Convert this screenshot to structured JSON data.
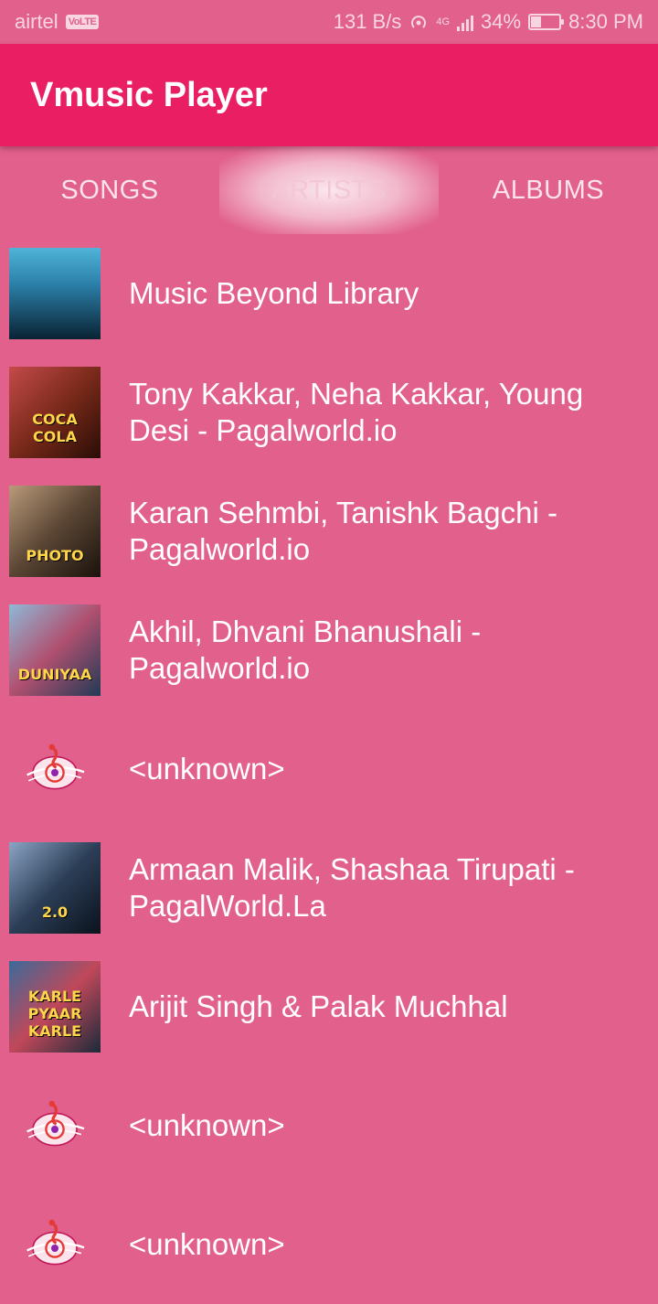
{
  "status_bar": {
    "carrier": "airtel",
    "volte": "VoLTE",
    "speed": "131 B/s",
    "network": "4G",
    "battery": "34%",
    "battery_level": 0.34,
    "time": "8:30 PM"
  },
  "app_bar": {
    "title": "Vmusic Player"
  },
  "tabs": [
    {
      "label": "SONGS"
    },
    {
      "label": "ARTISTS"
    },
    {
      "label": "ALBUMS"
    }
  ],
  "active_tab": "ARTISTS",
  "artists": [
    {
      "name": "Music Beyond Library",
      "thumb": "crowd",
      "thumb_text": ""
    },
    {
      "name": "Tony Kakkar, Neha Kakkar, Young Desi - Pagalworld.io",
      "thumb": "coca",
      "thumb_text": "COCA COLA"
    },
    {
      "name": "Karan Sehmbi, Tanishk Bagchi - Pagalworld.io",
      "thumb": "photo",
      "thumb_text": "PHOTO"
    },
    {
      "name": "Akhil, Dhvani Bhanushali - Pagalworld.io",
      "thumb": "duniya",
      "thumb_text": "DUNIYAA"
    },
    {
      "name": "<unknown>",
      "thumb": "note",
      "thumb_text": ""
    },
    {
      "name": "Armaan Malik, Shashaa Tirupati - PagalWorld.La",
      "thumb": "robot",
      "thumb_text": "2.0"
    },
    {
      "name": "Arijit Singh & Palak Muchhal",
      "thumb": "karle",
      "thumb_text": "KARLE PYAAR KARLE"
    },
    {
      "name": "<unknown>",
      "thumb": "note",
      "thumb_text": ""
    },
    {
      "name": "<unknown>",
      "thumb": "note",
      "thumb_text": ""
    }
  ]
}
